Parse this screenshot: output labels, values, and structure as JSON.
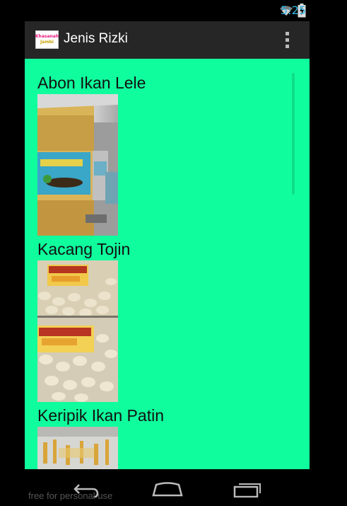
{
  "status": {
    "time": "5:25"
  },
  "app": {
    "title": "Jenis Rizki",
    "logo_line1": "Khasanah",
    "logo_line2": "Jambi"
  },
  "items": [
    {
      "name": "Abon Ikan Lele"
    },
    {
      "name": "Kacang Tojin"
    },
    {
      "name": "Keripik Ikan Patin"
    }
  ],
  "watermark": "free for personal use",
  "colors": {
    "background": "#10fd9d",
    "action_bar": "#262626",
    "status_time": "#33b5e5"
  },
  "icons": {
    "status": [
      "wifi-icon",
      "battery-charging-icon"
    ],
    "nav": [
      "back-icon",
      "home-icon",
      "recents-icon"
    ],
    "menu": "overflow-menu-icon"
  }
}
